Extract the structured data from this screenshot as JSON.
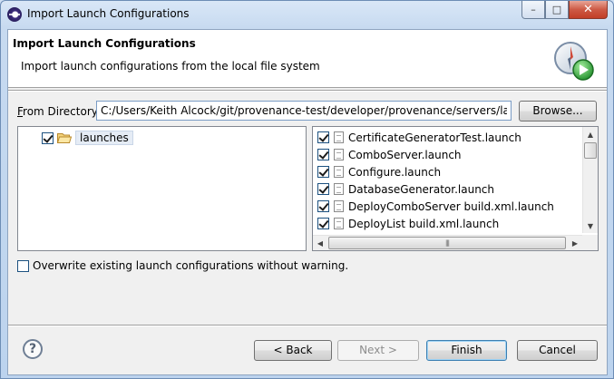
{
  "window": {
    "title": "Import Launch Configurations",
    "controls": {
      "minimize": "–",
      "maximize": "□",
      "close": "✕"
    }
  },
  "banner": {
    "title": "Import Launch Configurations",
    "description": "Import launch configurations from the local file system",
    "icon": "launch-import-icon"
  },
  "directory": {
    "label": "From Directory:",
    "value": "C:/Users/Keith Alcock/git/provenance-test/developer/provenance/servers/launches",
    "browse_label": "Browse..."
  },
  "folders": [
    {
      "name": "launches",
      "checked": true
    }
  ],
  "files": [
    {
      "name": "CertificateGeneratorTest.launch",
      "checked": true
    },
    {
      "name": "ComboServer.launch",
      "checked": true
    },
    {
      "name": "Configure.launch",
      "checked": true
    },
    {
      "name": "DatabaseGenerator.launch",
      "checked": true
    },
    {
      "name": "DeployComboServer build.xml.launch",
      "checked": true
    },
    {
      "name": "DeployList build.xml.launch",
      "checked": true
    }
  ],
  "options": {
    "overwrite_label": "Overwrite existing launch configurations without warning.",
    "overwrite_checked": false
  },
  "footer": {
    "help": "?",
    "back_label": "< Back",
    "next_label": "Next >",
    "finish_label": "Finish",
    "cancel_label": "Cancel"
  }
}
